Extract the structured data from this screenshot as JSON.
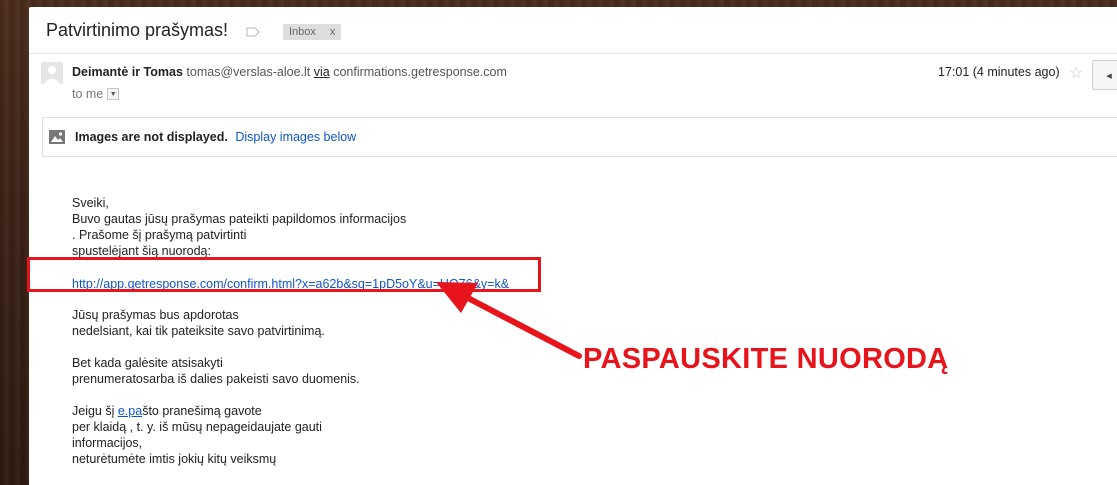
{
  "email": {
    "subject": "Patvirtinimo prašymas!",
    "label_badge": "Inbox",
    "label_remove": "x",
    "sender_name": "Deimantė ir Tomas",
    "sender_email": "tomas@verslas-aloe.lt",
    "via": "via",
    "via_domain": "confirmations.getresponse.com",
    "to": "to me",
    "time": "17:01 (4 minutes ago)",
    "star_icon": "☆",
    "reply_icon": "◂"
  },
  "images_notice": {
    "bold_text": "Images are not displayed.",
    "link_text": "Display images below"
  },
  "body": {
    "lines_1": [
      "Sveiki,",
      "Buvo gautas jūsų prašymas pateikti papildomos informacijos",
      ". Prašome šį prašymą patvirtinti",
      "spustelėjant šią nuorodą:"
    ],
    "confirm_link": "http://app.getresponse.com/confirm.html?x=a62b&sq=1pD5oY&u=HO76&y=k&",
    "lines_2": [
      "Jūsų prašymas bus apdorotas",
      "nedelsiant, kai tik pateiksite savo patvirtinimą."
    ],
    "lines_3": [
      "Bet kada galėsite atsisakyti",
      "prenumeratosarba iš dalies pakeisti savo duomenis."
    ],
    "line_4_prefix": "Jeigu šį ",
    "line_4_link_a": "e.pa",
    "line_4_suffix": "što pranešimą gavote",
    "lines_4_rest": [
      "per klaidą , t. y. iš mūsų nepageidaujate gauti",
      "informacijos,",
      "neturėtumėte imtis jokių kitų veiksmų"
    ]
  },
  "annotation": {
    "text": "PASPAUSKITE NUORODĄ",
    "color": "#e8141b"
  }
}
